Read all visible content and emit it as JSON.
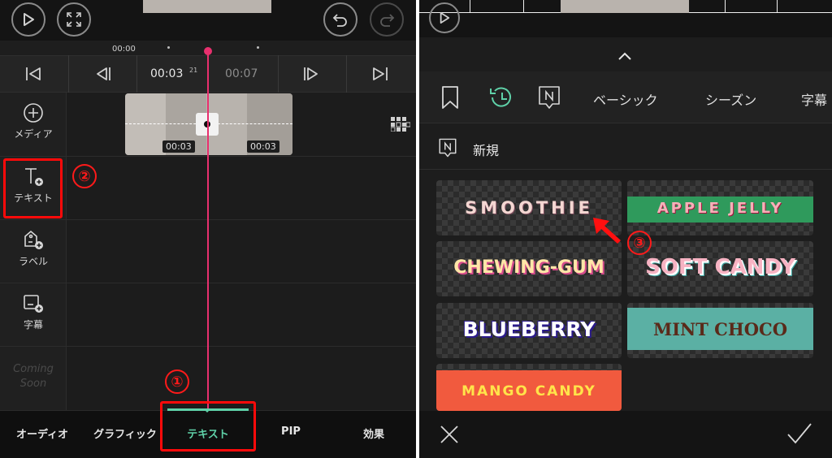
{
  "left": {
    "ruler": {
      "start": "00:00"
    },
    "controls": {
      "time_current": "00:03",
      "time_frames": "21",
      "time_total": "00:07"
    },
    "clip": {
      "duration_a": "00:03",
      "duration_b": "00:03"
    },
    "tools": [
      {
        "label": "メディア"
      },
      {
        "label": "テキスト"
      },
      {
        "label": "ラベル"
      },
      {
        "label": "字幕"
      }
    ],
    "coming_soon": {
      "line1": "Coming",
      "line2": "Soon"
    },
    "bottom_tabs": [
      "オーディオ",
      "グラフィック",
      "テキスト",
      "PIP",
      "効果"
    ],
    "annotations": {
      "step1": "①",
      "step2": "②"
    }
  },
  "right": {
    "categories": [
      "ベーシック",
      "シーズン",
      "字幕"
    ],
    "section_title": "新規",
    "presets": [
      {
        "label": "SMOOTHIE"
      },
      {
        "label": "APPLE JELLY"
      },
      {
        "label": "CHEWING-GUM"
      },
      {
        "label": "SOFT CANDY"
      },
      {
        "label": "BLUEBERRY"
      },
      {
        "label": "MINT CHOCO"
      },
      {
        "label": "MANGO CANDY"
      }
    ],
    "annotations": {
      "step3": "③"
    }
  },
  "colors": {
    "accent": "#5fd1a8",
    "playhead": "#e8306e",
    "annotation": "#ff1a1a"
  },
  "icons": [
    "play-icon",
    "fullscreen-icon",
    "undo-icon",
    "redo-icon",
    "skip-start-icon",
    "frame-back-icon",
    "frame-forward-icon",
    "skip-end-icon",
    "layout-grid-icon",
    "bookmark-icon",
    "recent-icon",
    "new-badge-icon",
    "close-icon",
    "check-icon",
    "chevron-up-icon"
  ]
}
